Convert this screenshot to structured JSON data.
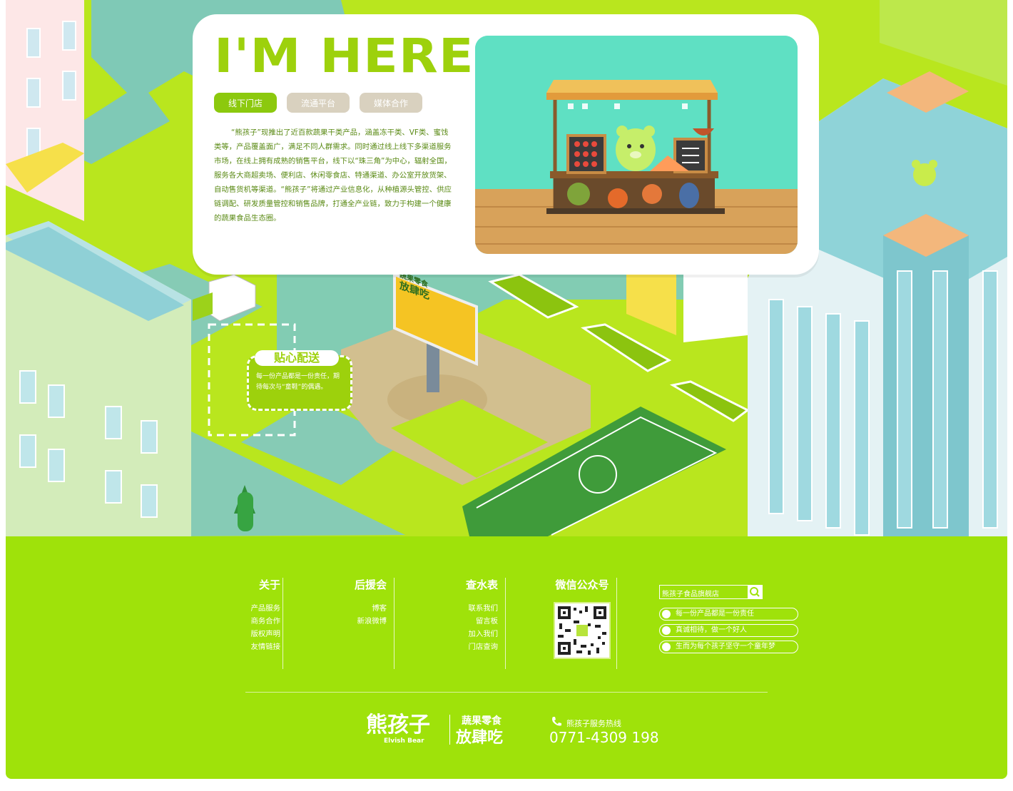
{
  "hero": {
    "headline": "I'M HERE",
    "tabs": [
      {
        "label": "线下门店",
        "active": true
      },
      {
        "label": "流通平台",
        "active": false
      },
      {
        "label": "媒体合作",
        "active": false
      }
    ],
    "description": "“熊孩子”现推出了近百款蔬果干类产品，涵盖冻干类、VF类、蜜饯类等，产品覆盖面广，满足不同人群需求。同时通过线上线下多渠道服务市场，在线上拥有成熟的销售平台，线下以“珠三角”为中心，辐射全国，服务各大商超卖场、便利店、休闲零食店、特通渠道、办公室开放货架、自动售货机等渠道。“熊孩子”将通过产业信息化，从种植源头管控、供应链调配、研发质量管控和销售品牌，打通全产业链，致力于构建一个健康的蔬果食品生态圈。"
  },
  "delivery": {
    "title": "贴心配送",
    "text": "每一份产品都是一份责任，期待每次与“童鞋”的偶遇。"
  },
  "billboard": {
    "line1": "蔬果零食",
    "line2": "放肆吃"
  },
  "footer": {
    "columns": [
      {
        "title": "关于",
        "links": [
          "产品服务",
          "商务合作",
          "版权声明",
          "友情链接"
        ]
      },
      {
        "title": "后援会",
        "links": [
          "博客",
          "新浪微博"
        ]
      },
      {
        "title": "查水表",
        "links": [
          "联系我们",
          "留言板",
          "加入我们",
          "门店查询"
        ]
      }
    ],
    "wechat_title": "微信公众号",
    "search_placeholder": "熊孩子食品旗舰店",
    "slogans": [
      "每一份产品都是一份责任",
      "真诚相待，做一个好人",
      "生而为每个孩子坚守一个童年梦"
    ],
    "brand_cn": "熊孩子",
    "brand_en": "Elvish Bear",
    "brand_tag1": "蔬果零食",
    "brand_tag2": "放肆吃",
    "hotline_label": "熊孩子服务热线",
    "hotline_number": "0771-4309 198"
  },
  "colors": {
    "accent": "#9dd10c",
    "footer_bg": "#9fe20a",
    "scene_bg": "#b9e61e",
    "tab_inactive": "#d9d1bf"
  },
  "icons": [
    "search-icon",
    "phone-icon",
    "qr-code",
    "slogan-icon"
  ]
}
